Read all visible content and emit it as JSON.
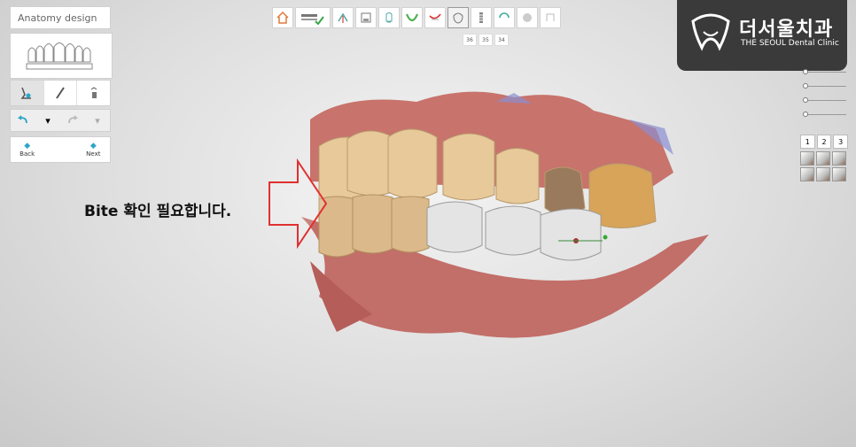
{
  "app": {
    "mode_title": "Anatomy design"
  },
  "left_panel": {
    "undo_label": "▾",
    "redo_label": "▾",
    "back_label": "Back",
    "next_label": "Next"
  },
  "toolbar": {
    "icons": [
      "home-icon",
      "margin-icon",
      "insertion-icon",
      "save-icon",
      "copy-tooth-icon",
      "arch-icon",
      "crown-view-icon",
      "anatomy-icon",
      "implant-icon",
      "connector-icon",
      "smooth-icon",
      "finish-icon"
    ]
  },
  "tooth_tabs": [
    "36",
    "35",
    "34"
  ],
  "logo": {
    "korean": "더서울치과",
    "english": "THE SEOUL Dental Clinic"
  },
  "view_presets": [
    "1",
    "2",
    "3"
  ],
  "annotation": {
    "text": "Bite 확인 필요합니다.",
    "arrow_color": "#e03030"
  },
  "colors": {
    "accent": "#2ba6c9",
    "logo_bg": "#3a3a3a",
    "gum": "#c9726a",
    "crown": "#e6e6e6"
  }
}
